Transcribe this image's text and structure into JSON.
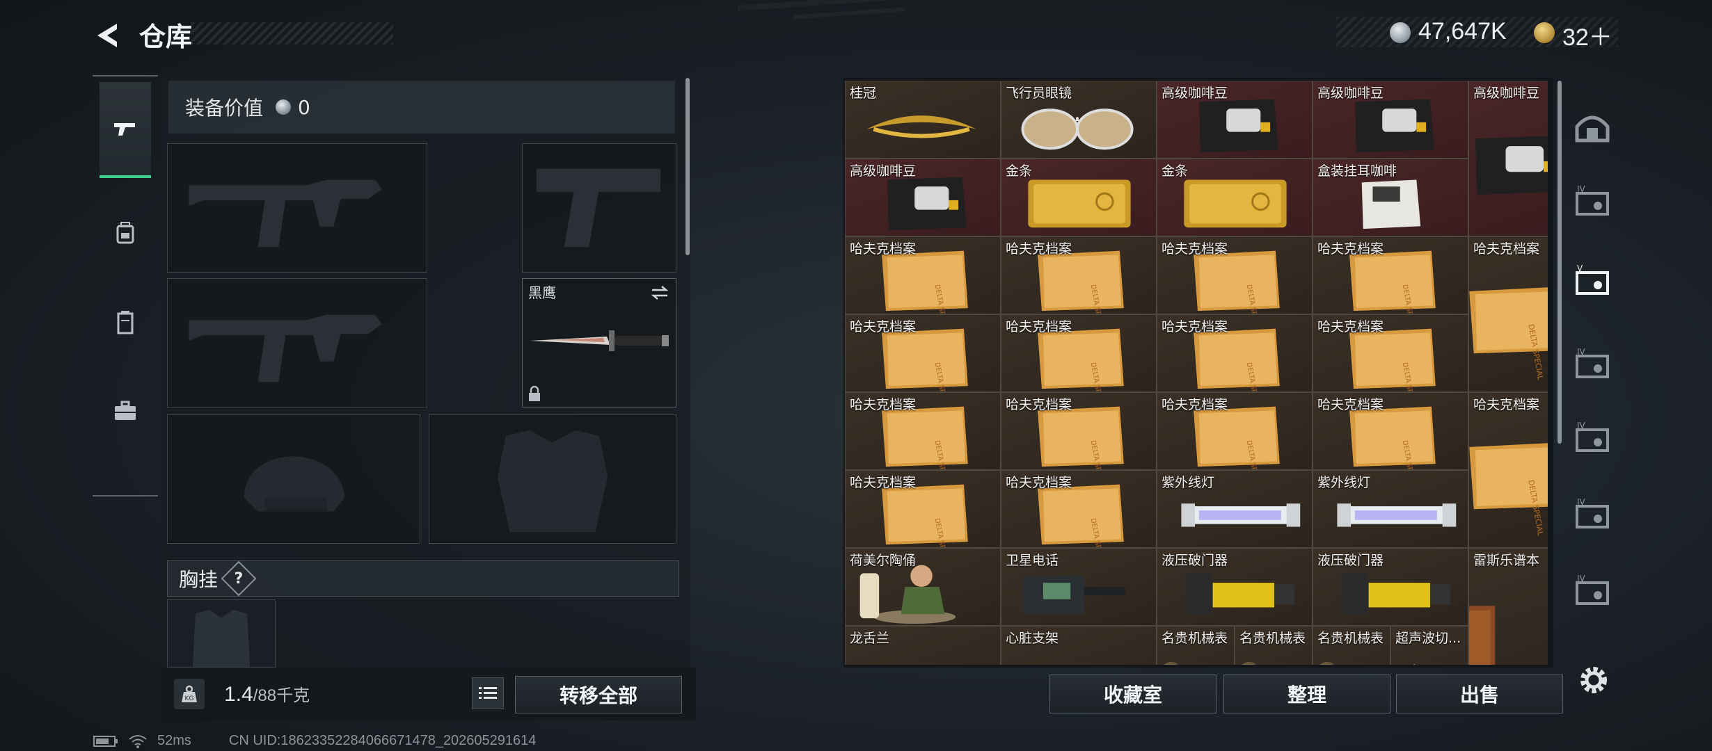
{
  "header": {
    "title": "仓库"
  },
  "currency": {
    "silver": "47,647K",
    "gold": "32＋"
  },
  "left_tabs": [
    {
      "name": "weapon",
      "icon": "pistol-icon",
      "selected": true
    },
    {
      "name": "backpack",
      "icon": "backpack-icon",
      "selected": false
    },
    {
      "name": "container",
      "icon": "locker-icon",
      "selected": false
    },
    {
      "name": "case",
      "icon": "briefcase-icon",
      "selected": false
    }
  ],
  "equipment": {
    "value_label": "装备价值",
    "value": "0",
    "melee_slot": {
      "name": "黑鹰",
      "icon": "swap-icon",
      "lock_icon": "lock-icon"
    },
    "chest_rig_label": "胸挂",
    "chest_rig_help": "?"
  },
  "weight": {
    "current": "1.4",
    "max": "/88千克",
    "icon": "weight-icon"
  },
  "buttons": {
    "transfer_all": "转移全部",
    "collection_room": "收藏室",
    "sort": "整理",
    "sell": "出售"
  },
  "status": {
    "ping": "52ms",
    "uid": "CN UID:18623352284066671478_202605291614"
  },
  "colors": {
    "accent_green": "#3ccf8b",
    "rare_cell": "#4a2628",
    "common_cell": "#3a3026",
    "panel": "#1c2227"
  },
  "inventory": [
    {
      "label": "桂冠",
      "item": "laurel-wreath",
      "rarity": "gold"
    },
    {
      "label": "飞行员眼镜",
      "item": "aviator-glasses",
      "rarity": "gold"
    },
    {
      "label": "高级咖啡豆",
      "item": "coffee-bag",
      "rarity": "red"
    },
    {
      "label": "高级咖啡豆",
      "item": "coffee-bag",
      "rarity": "red"
    },
    {
      "label": "高级咖啡豆",
      "item": "coffee-bag",
      "rarity": "red"
    },
    {
      "label": "高级咖啡豆",
      "item": "coffee-bag",
      "rarity": "red"
    },
    {
      "label": "金条",
      "item": "gold-bar",
      "rarity": "red"
    },
    {
      "label": "金条",
      "item": "gold-bar",
      "rarity": "red"
    },
    {
      "label": "盒装挂耳咖啡",
      "item": "coffee-box",
      "rarity": "red"
    },
    {
      "label": "哈夫克档案",
      "item": "file",
      "rarity": "gold"
    },
    {
      "label": "哈夫克档案",
      "item": "file",
      "rarity": "gold"
    },
    {
      "label": "哈夫克档案",
      "item": "file",
      "rarity": "gold"
    },
    {
      "label": "哈夫克档案",
      "item": "file",
      "rarity": "gold"
    },
    {
      "label": "哈夫克档案",
      "item": "file",
      "rarity": "gold"
    },
    {
      "label": "哈夫克档案",
      "item": "file",
      "rarity": "gold"
    },
    {
      "label": "哈夫克档案",
      "item": "file",
      "rarity": "gold"
    },
    {
      "label": "哈夫克档案",
      "item": "file",
      "rarity": "gold"
    },
    {
      "label": "哈夫克档案",
      "item": "file",
      "rarity": "gold"
    },
    {
      "label": "哈夫克档案",
      "item": "file",
      "rarity": "gold"
    },
    {
      "label": "哈夫克档案",
      "item": "file",
      "rarity": "gold"
    },
    {
      "label": "哈夫克档案",
      "item": "file",
      "rarity": "gold"
    },
    {
      "label": "哈夫克档案",
      "item": "file",
      "rarity": "gold"
    },
    {
      "label": "哈夫克档案",
      "item": "file",
      "rarity": "gold"
    },
    {
      "label": "哈夫克档案",
      "item": "file",
      "rarity": "gold"
    },
    {
      "label": "哈夫克档案",
      "item": "file",
      "rarity": "gold"
    },
    {
      "label": "紫外线灯",
      "item": "uv-lamp",
      "rarity": "gold"
    },
    {
      "label": "紫外线灯",
      "item": "uv-lamp",
      "rarity": "gold"
    },
    {
      "label": "荷美尔陶俑",
      "item": "figurine",
      "rarity": "gold"
    },
    {
      "label": "卫星电话",
      "item": "sat-phone",
      "rarity": "gold"
    },
    {
      "label": "液压破门器",
      "item": "breacher",
      "rarity": "gold"
    },
    {
      "label": "液压破门器",
      "item": "breacher",
      "rarity": "gold"
    },
    {
      "label": "雷斯乐谱本",
      "item": "notebook",
      "rarity": "gold"
    },
    {
      "label": "龙舌兰",
      "item": "bottle",
      "rarity": "gold"
    },
    {
      "label": "心脏支架",
      "item": "stent",
      "rarity": "gold"
    },
    {
      "label": "名贵机械表",
      "item": "watch",
      "rarity": "gold"
    },
    {
      "label": "名贵机械表",
      "item": "watch",
      "rarity": "gold"
    },
    {
      "label": "名贵机械表",
      "item": "watch",
      "rarity": "gold"
    },
    {
      "label": "超声波切...",
      "item": "tool",
      "rarity": "gold"
    }
  ],
  "right_tabs": [
    {
      "icon": "warehouse-icon"
    },
    {
      "icon": "storage-iv-icon"
    },
    {
      "icon": "storage-v-icon"
    },
    {
      "icon": "storage-iv-2-icon"
    },
    {
      "icon": "storage-iv-3-icon"
    },
    {
      "icon": "storage-folder-icon"
    },
    {
      "icon": "storage-iv-4-icon"
    }
  ]
}
